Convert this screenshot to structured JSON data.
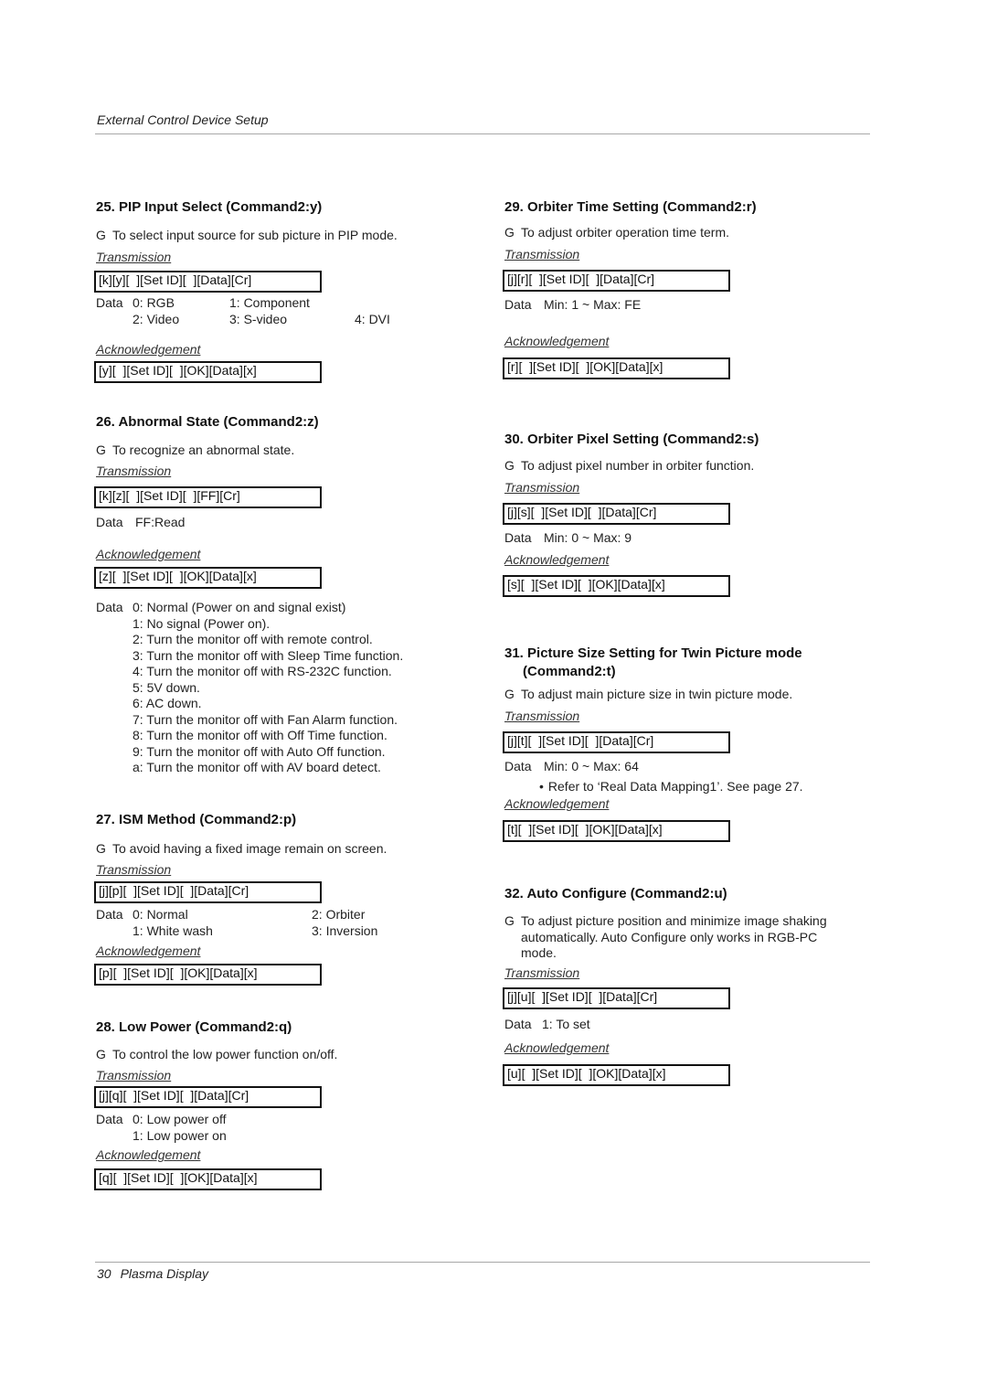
{
  "header": {
    "running_head": "External Control Device Setup"
  },
  "footer": {
    "page_number": "30",
    "title": "Plasma Display"
  },
  "bullet_glyph": "G",
  "labels": {
    "transmission": "Transmission",
    "acknowledgement": "Acknowledgement",
    "data": "Data"
  },
  "sections": {
    "s25": {
      "title": "25. PIP Input Select (Command2:y)",
      "desc": "To select input source for sub picture in PIP mode.",
      "transmission": "[k][y][  ][Set ID][  ][Data][Cr]",
      "data": [
        [
          "0: RGB",
          "1: Component",
          ""
        ],
        [
          "2: Video",
          "3: S-video",
          "4: DVI"
        ]
      ],
      "ack": "[y][  ][Set ID][  ][OK][Data][x]"
    },
    "s26": {
      "title": "26. Abnormal State (Command2:z)",
      "desc": "To recognize an abnormal state.",
      "transmission": "[k][z][  ][Set ID][  ][FF][Cr]",
      "data_read": "FF:Read",
      "ack": "[z][  ][Set ID][  ][OK][Data][x]",
      "ack_data": [
        "0: Normal (Power on and signal exist)",
        "1: No signal (Power on).",
        "2: Turn the monitor off with remote control.",
        "3: Turn the monitor off with Sleep Time function.",
        "4: Turn the monitor off with RS-232C function.",
        "5: 5V down.",
        "6: AC down.",
        "7: Turn the monitor off with Fan Alarm function.",
        "8: Turn the monitor off with Off Time function.",
        "9: Turn the monitor off with Auto Off function.",
        "a: Turn the monitor off with AV board detect."
      ]
    },
    "s27": {
      "title": "27. ISM Method (Command2:p)",
      "desc": "To avoid having a fixed image remain on screen.",
      "transmission": "[j][p][  ][Set ID][  ][Data][Cr]",
      "data": [
        [
          "0: Normal",
          "2: Orbiter"
        ],
        [
          "1: White wash",
          "3: Inversion"
        ]
      ],
      "ack": "[p][  ][Set ID][  ][OK][Data][x]"
    },
    "s28": {
      "title": "28. Low Power (Command2:q)",
      "desc": "To control the low power function on/off.",
      "transmission": "[j][q][  ][Set ID][  ][Data][Cr]",
      "data": [
        "0: Low power off",
        "1: Low power on"
      ],
      "ack": "[q][  ][Set ID][  ][OK][Data][x]"
    },
    "s29": {
      "title": "29. Orbiter Time Setting (Command2:r)",
      "desc": "To adjust orbiter operation time term.",
      "transmission": "[j][r][  ][Set ID][  ][Data][Cr]",
      "data": "Min: 1 ~ Max: FE",
      "ack": "[r][  ][Set ID][  ][OK][Data][x]"
    },
    "s30": {
      "title": "30. Orbiter Pixel Setting (Command2:s)",
      "desc": "To adjust pixel number in orbiter function.",
      "transmission": "[j][s][  ][Set ID][  ][Data][Cr]",
      "data": "Min: 0 ~ Max: 9",
      "ack": "[s][  ][Set ID][  ][OK][Data][x]"
    },
    "s31": {
      "title_line1": "31. Picture Size Setting for Twin Picture mode",
      "title_line2": "(Command2:t)",
      "desc": "To adjust main picture size in twin picture mode.",
      "transmission": "[j][t][  ][Set ID][  ][Data][Cr]",
      "data": "Min: 0 ~ Max: 64",
      "note": "Refer to ‘Real Data Mapping1’. See page 27.",
      "ack": "[t][  ][Set ID][  ][OK][Data][x]"
    },
    "s32": {
      "title": "32. Auto Configure (Command2:u)",
      "desc_lines": [
        "To adjust picture position and minimize image shaking",
        "automatically. Auto Configure only works in RGB-PC",
        "mode."
      ],
      "transmission": "[j][u][  ][Set ID][  ][Data][Cr]",
      "data": "1: To set",
      "ack": "[u][  ][Set ID][  ][OK][Data][x]"
    }
  }
}
